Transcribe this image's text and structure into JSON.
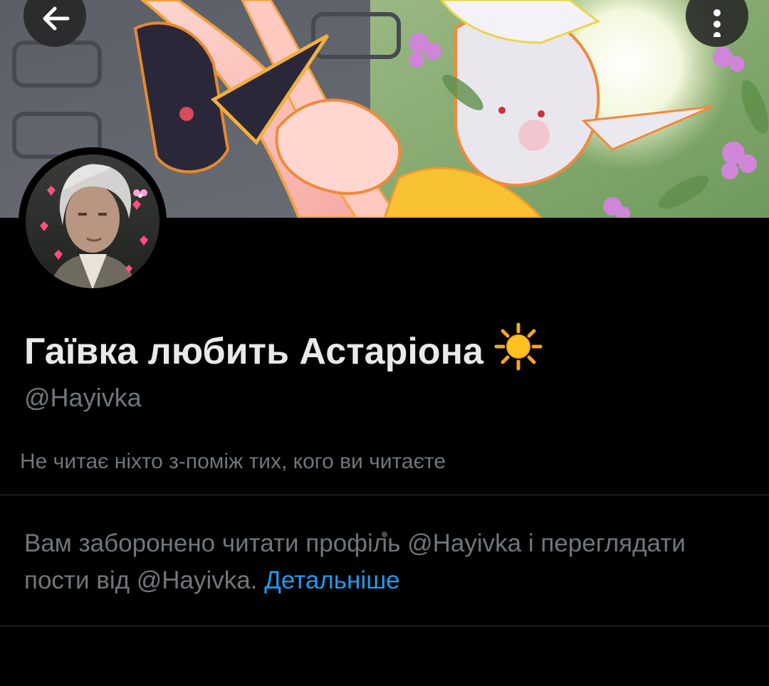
{
  "header": {
    "back_icon": "arrow-left-icon",
    "more_icon": "more-vertical-icon"
  },
  "profile": {
    "display_name": "Гаївка любить Астаріона",
    "name_emoji": "sun-emoji",
    "handle": "@Hayivka",
    "followers_you_know": "Не читає ніхто з-поміж тих, кого ви читаєте"
  },
  "blocked_notice": {
    "message": "Вам заборонено читати профіль @Hayivka і переглядати пости від @Hayivka.",
    "link_label": "Детальніше"
  },
  "colors": {
    "background": "#000000",
    "primary_text": "#e7e9ea",
    "secondary_text": "#71767b",
    "link": "#1d9bf0",
    "divider": "#2f3336"
  }
}
